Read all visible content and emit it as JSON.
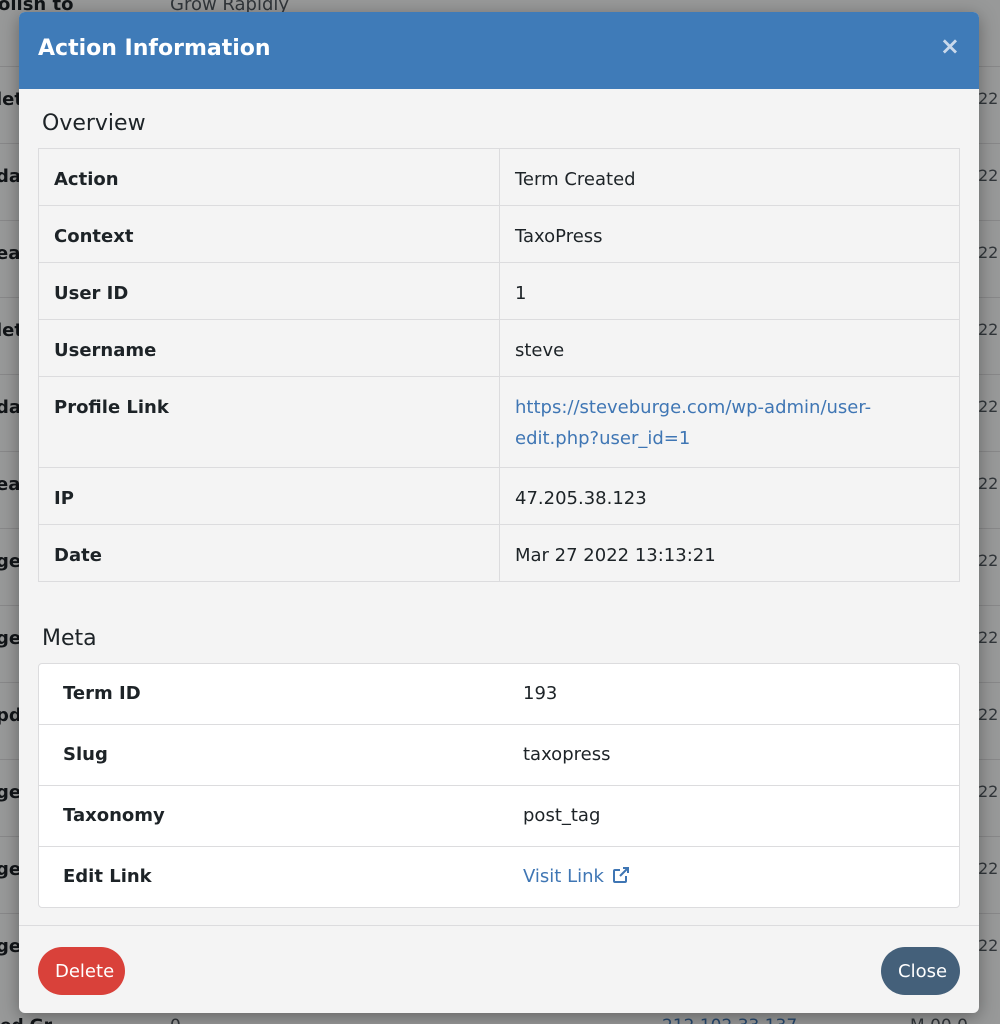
{
  "background": {
    "top_left": "olish to",
    "top_right": "Grow Rapidly",
    "row_left_fragments": [
      "let",
      "da",
      "eat",
      "let",
      "da",
      "eat",
      "ge",
      "ge",
      "pd",
      "ge",
      "ge",
      "ge"
    ],
    "row_right_fragment": "22",
    "bottom_left": "ed Gr",
    "bottom_mid": "0",
    "bottom_ip": "212.102.33.137",
    "bottom_right": "M 00.0"
  },
  "modal": {
    "title": "Action Information",
    "close_glyph": "×",
    "overview_heading": "Overview",
    "overview_rows": [
      {
        "label": "Action",
        "value": "Term Created"
      },
      {
        "label": "Context",
        "value": "TaxoPress"
      },
      {
        "label": "User ID",
        "value": "1"
      },
      {
        "label": "Username",
        "value": "steve"
      },
      {
        "label": "Profile Link",
        "value": "https://steveburge.com/wp-admin/user-edit.php?user_id=1",
        "is_link": true
      },
      {
        "label": "IP",
        "value": "47.205.38.123"
      },
      {
        "label": "Date",
        "value": "Mar 27 2022 13:13:21"
      }
    ],
    "meta_heading": "Meta",
    "meta_rows": [
      {
        "label": "Term ID",
        "value": "193"
      },
      {
        "label": "Slug",
        "value": "taxopress"
      },
      {
        "label": "Taxonomy",
        "value": "post_tag"
      },
      {
        "label": "Edit Link",
        "value": "Visit Link",
        "is_link": true,
        "icon": "external-link-icon"
      }
    ],
    "delete_label": "Delete",
    "close_label": "Close"
  },
  "colors": {
    "header": "#3f7bb8",
    "link": "#3f76b4",
    "delete": "#d9413a",
    "close": "#44607a"
  }
}
